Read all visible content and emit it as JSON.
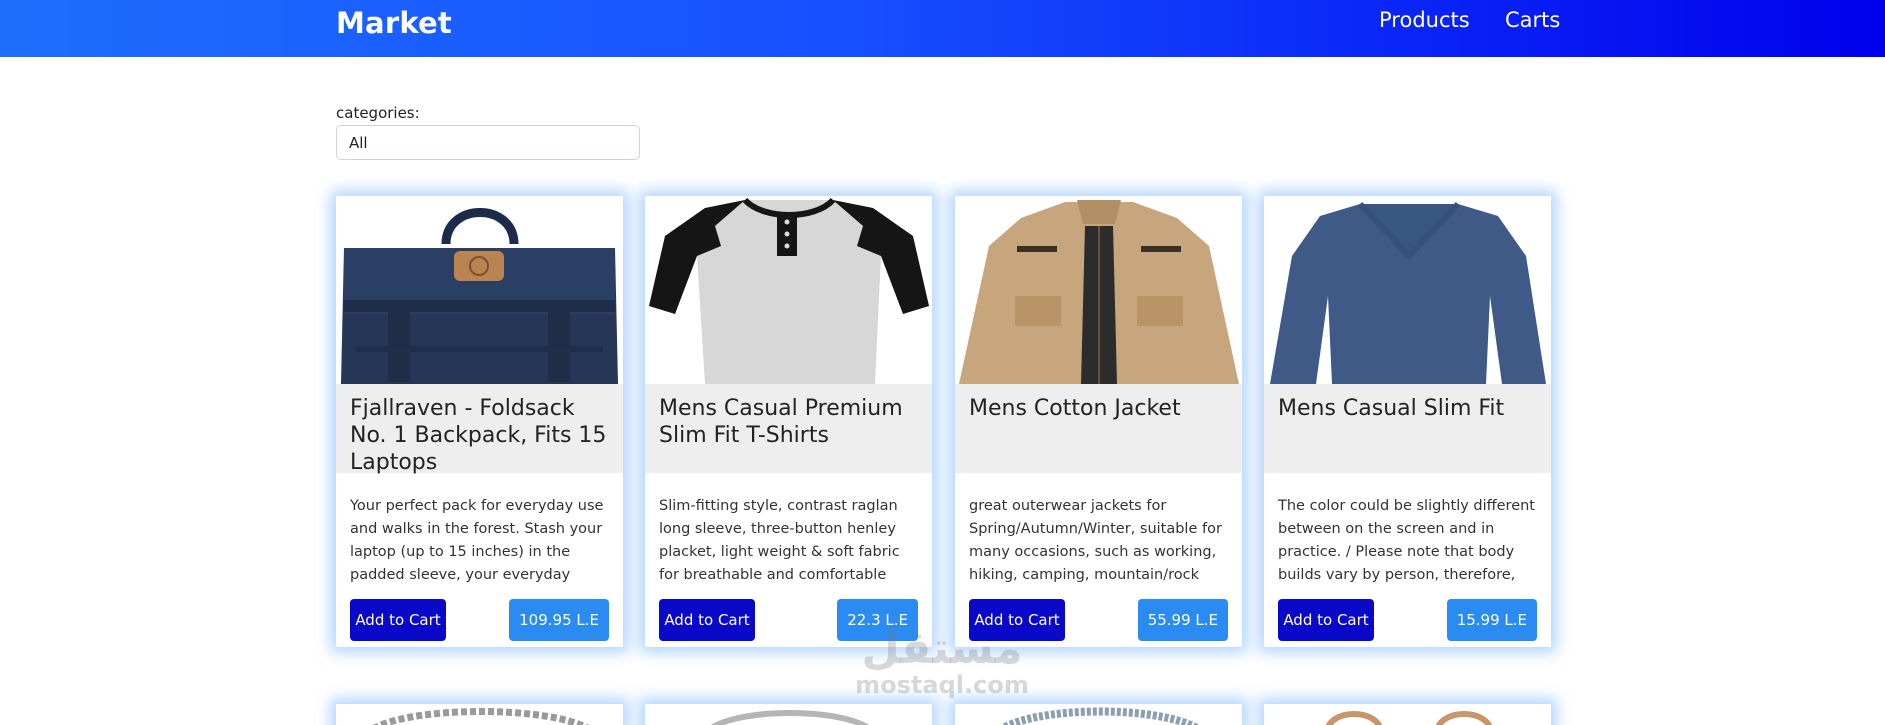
{
  "navbar": {
    "brand": "Market",
    "links": [
      "Products",
      "Carts"
    ],
    "gradient_start": "#1f6dfd",
    "gradient_end": "#0000ee"
  },
  "filter": {
    "label": "categories:",
    "selected": "All"
  },
  "products": [
    {
      "title": "Fjallraven - Foldsack No. 1 Backpack, Fits 15 Laptops",
      "description": "Your perfect pack for everyday use and walks in the forest. Stash your laptop (up to 15 inches) in the padded sleeve, your everyday",
      "button": "Add to Cart",
      "price": "109.95 L.E",
      "image": "navy-backpack"
    },
    {
      "title": "Mens Casual Premium Slim Fit T-Shirts",
      "description": "Slim-fitting style, contrast raglan long sleeve, three-button henley placket, light weight & soft fabric for breathable and comfortable wearing.",
      "button": "Add to Cart",
      "price": "22.3 L.E",
      "image": "raglan-henley-shirt"
    },
    {
      "title": "Mens Cotton Jacket",
      "description": "great outerwear jackets for Spring/Autumn/Winter, suitable for many occasions, such as working, hiking, camping, mountain/rock",
      "button": "Add to Cart",
      "price": "55.99 L.E",
      "image": "khaki-jacket"
    },
    {
      "title": "Mens Casual Slim Fit",
      "description": "The color could be slightly different between on the screen and in practice. / Please note that body builds vary by person, therefore, detailed size",
      "button": "Add to Cart",
      "price": "15.99 L.E",
      "image": "blue-long-sleeve-shirt"
    }
  ],
  "colors": {
    "add_button": "#0a08c9",
    "price_badge": "#2a8cf3",
    "card_glow": "#78b4ff",
    "title_bg": "#eeeeee"
  },
  "watermark": {
    "arabic": "مستقل",
    "latin": "mostaql.com"
  }
}
